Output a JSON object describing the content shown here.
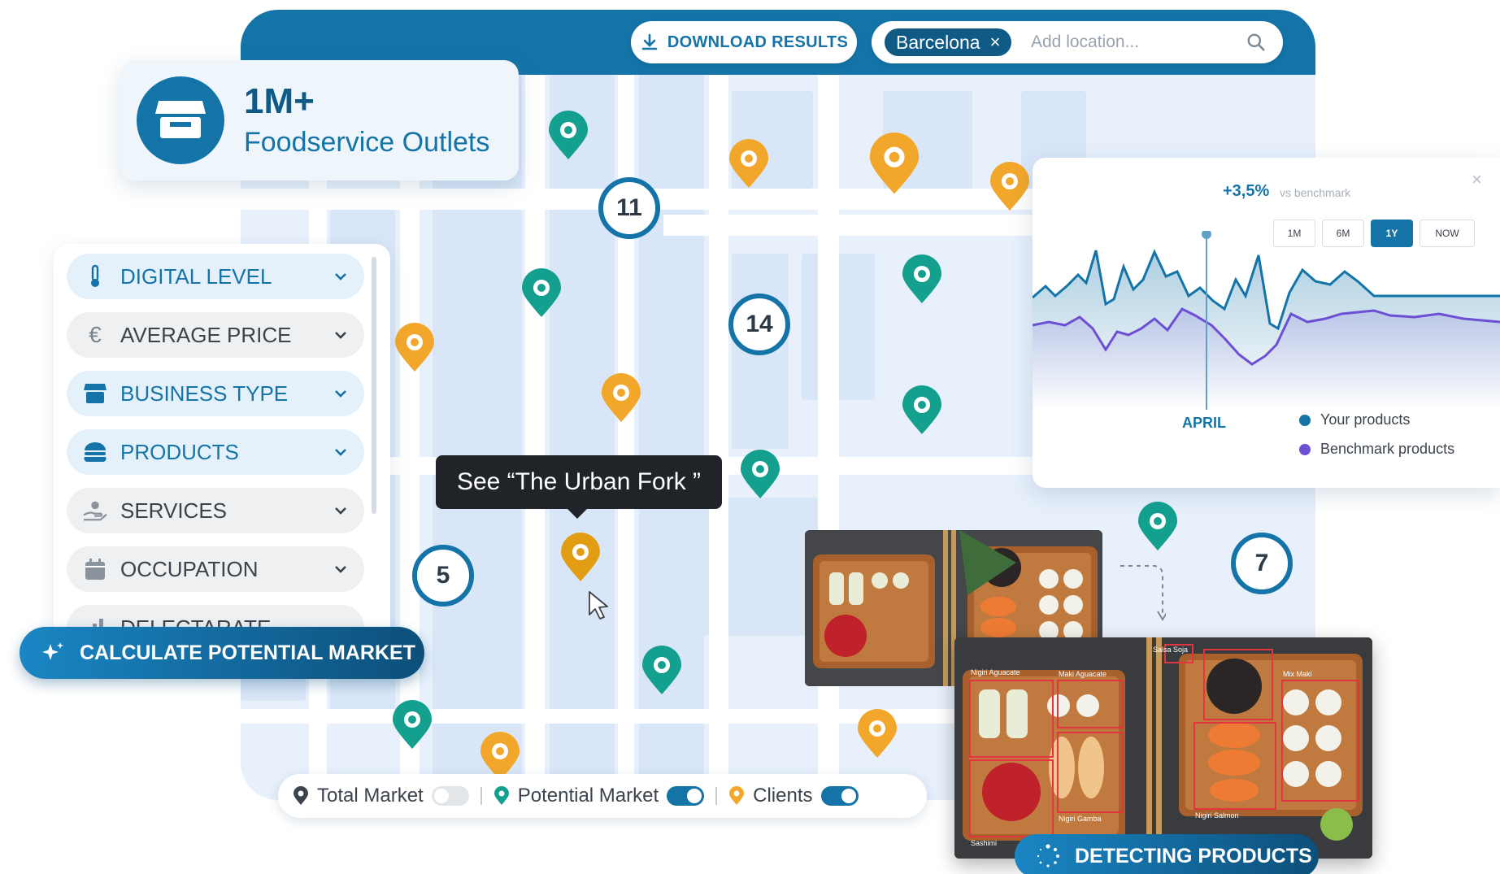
{
  "header": {
    "download_label": "DOWNLOAD RESULTS",
    "location_chip": "Barcelona",
    "location_chip_remove": "×",
    "location_placeholder": "Add location..."
  },
  "outlets_card": {
    "number": "1M+",
    "label": "Foodservice Outlets"
  },
  "filters": [
    {
      "label": "DIGITAL LEVEL",
      "icon": "thermometer-icon",
      "active": true
    },
    {
      "label": "AVERAGE PRICE",
      "icon": "euro-icon",
      "active": false
    },
    {
      "label": "BUSINESS TYPE",
      "icon": "store-icon",
      "active": true
    },
    {
      "label": "PRODUCTS",
      "icon": "burger-icon",
      "active": true
    },
    {
      "label": "SERVICES",
      "icon": "service-hand-icon",
      "active": false
    },
    {
      "label": "OCCUPATION",
      "icon": "calendar-icon",
      "active": false
    },
    {
      "label": "DELECTARATE",
      "icon": "chart-icon",
      "active": false
    }
  ],
  "calculate_button": "CALCULATE POTENTIAL MARKET",
  "tooltip": "See “The Urban Fork ”",
  "clusters": [
    "11",
    "14",
    "5",
    "7"
  ],
  "legend": {
    "total_market": "Total Market",
    "total_market_on": false,
    "potential_market": "Potential Market",
    "potential_market_on": true,
    "clients": "Clients",
    "clients_on": true
  },
  "chart": {
    "delta": "+3,5%",
    "vs_label": "vs benchmark",
    "close": "×",
    "ranges": [
      "1M",
      "6M",
      "1Y",
      "NOW"
    ],
    "active_range": "1Y",
    "marker_label": "APRIL",
    "legend": [
      {
        "label": "Your products",
        "color": "#1474a8"
      },
      {
        "label": "Benchmark products",
        "color": "#6d4fd6"
      }
    ]
  },
  "detection": {
    "labels": [
      "Nigiri Aguacate",
      "Maki Aguacate",
      "Salsa Soja",
      "Mix Maki",
      "Sashimi",
      "Nigiri Gamba",
      "Nigiri Salmon"
    ],
    "button": "DETECTING PRODUCTS"
  },
  "colors": {
    "brand": "#1474a8",
    "brand_dark": "#0f5b86",
    "teal_pin": "#13a08f",
    "orange_pin": "#f2a72a",
    "benchmark": "#6d4fd6"
  }
}
